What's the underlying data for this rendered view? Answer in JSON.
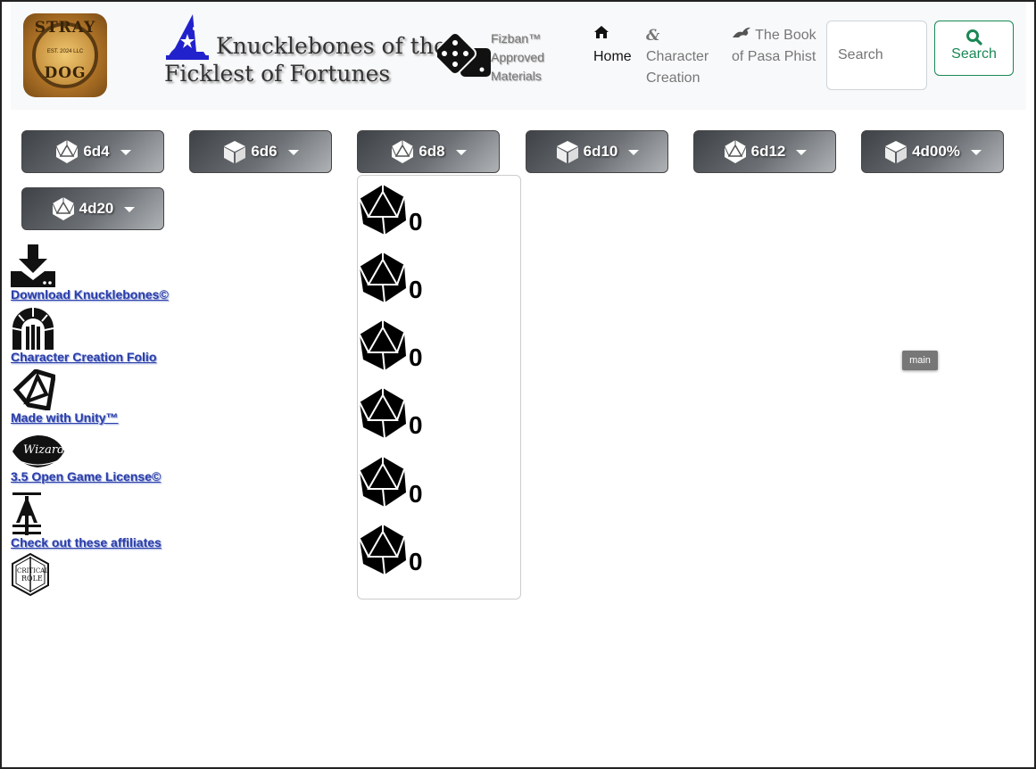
{
  "header": {
    "logo_top": "STRAY",
    "logo_bottom": "DOG",
    "logo_mid": "EST. 2024   LLC",
    "title_line1": "Knucklebones of the",
    "title_line2": "Ficklest of Fortunes",
    "fizban": [
      "Fizban™",
      "Approved",
      "Materials"
    ]
  },
  "nav": {
    "home": "Home",
    "character": [
      "Character",
      "Creation"
    ],
    "book": [
      "The Book",
      "of Pasa Phist"
    ],
    "search_placeholder": "Search",
    "search_button": "Search"
  },
  "dice": [
    {
      "label": "6d4",
      "icon": "d20-icon"
    },
    {
      "label": "6d6",
      "icon": "cube-icon"
    },
    {
      "label": "6d8",
      "icon": "d20-icon"
    },
    {
      "label": "6d10",
      "icon": "cube-icon"
    },
    {
      "label": "6d12",
      "icon": "d20-icon"
    },
    {
      "label": "4d00%",
      "icon": "cube-icon"
    },
    {
      "label": "4d20",
      "icon": "d20-icon"
    }
  ],
  "rolls": [
    "0",
    "0",
    "0",
    "0",
    "0",
    "0"
  ],
  "sidebar": [
    {
      "label": "Download Knucklebones©",
      "icon": "download-icon"
    },
    {
      "label": "Character Creation Folio",
      "icon": "archway-icon"
    },
    {
      "label": "Made with Unity™",
      "icon": "unity-icon"
    },
    {
      "label": "3.5 Open Game License©",
      "icon": "wizards-icon"
    },
    {
      "label": "Check out these affiliates",
      "icon": "affiliate-icon"
    }
  ],
  "tooltip": "main"
}
